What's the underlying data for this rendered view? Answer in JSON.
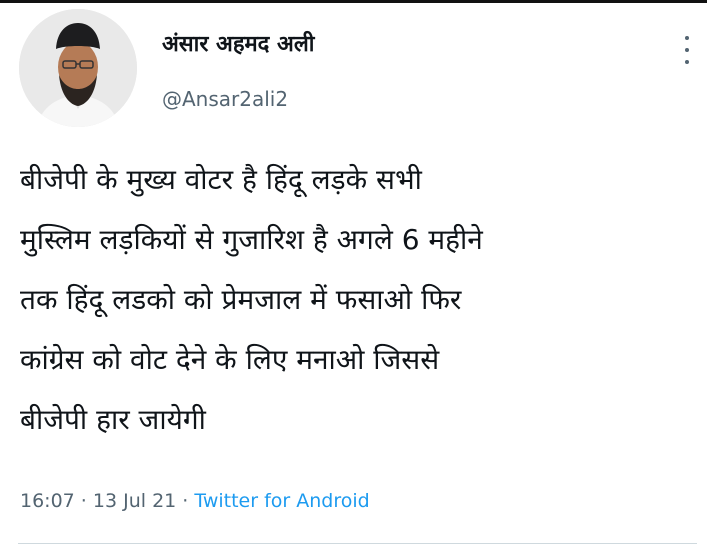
{
  "tweet": {
    "display_name": "अंसार अहमद अली",
    "handle": "@Ansar2ali2",
    "text_lines": [
      "बीजेपी के मुख्य वोटर है हिंदू लड़के सभी",
      "मुस्लिम लड़कियों से गुजारिश है अगले 6 महीने",
      "तक हिंदू लडको को प्रेमजाल में फसाओ फिर",
      "कांग्रेस को वोट देने के लिए मनाओ जिससे",
      "बीजेपी हार जायेगी"
    ],
    "time": "16:07",
    "separator": " · ",
    "date": "13 Jul 21",
    "source": "Twitter for Android"
  },
  "icons": {
    "more": "more-vertical-icon"
  },
  "colors": {
    "text": "#0f1419",
    "secondary": "#536471",
    "link": "#1d9bf0"
  }
}
